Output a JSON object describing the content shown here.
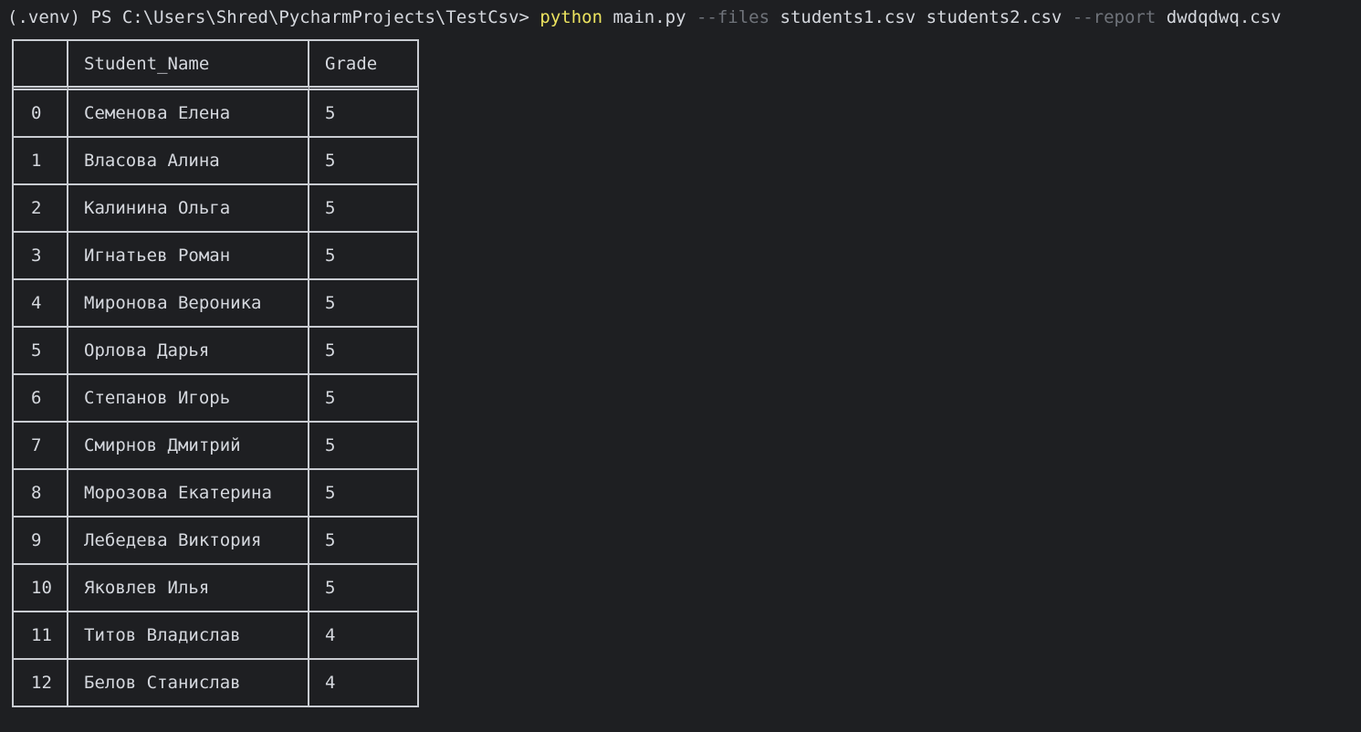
{
  "command": {
    "prompt": "(.venv) PS C:\\Users\\Shred\\PycharmProjects\\TestCsv> ",
    "executable": "python",
    "script": " main.py ",
    "files_flag": "--files",
    "files": " students1.csv students2.csv ",
    "report_flag": "--report",
    "report_file": " dwdqdwq.csv"
  },
  "table": {
    "headers": [
      "",
      "Student_Name",
      "Grade"
    ],
    "rows": [
      [
        "0",
        "Семенова Елена",
        "5"
      ],
      [
        "1",
        "Власова Алина",
        "5"
      ],
      [
        "2",
        "Калинина Ольга",
        "5"
      ],
      [
        "3",
        "Игнатьев Роман",
        "5"
      ],
      [
        "4",
        "Миронова Вероника",
        "5"
      ],
      [
        "5",
        "Орлова Дарья",
        "5"
      ],
      [
        "6",
        "Степанов Игорь",
        "5"
      ],
      [
        "7",
        "Смирнов Дмитрий",
        "5"
      ],
      [
        "8",
        "Морозова Екатерина",
        "5"
      ],
      [
        "9",
        "Лебедева Виктория",
        "5"
      ],
      [
        "10",
        "Яковлев Илья",
        "5"
      ],
      [
        "11",
        "Титов Владислав",
        "4"
      ],
      [
        "12",
        "Белов Станислав",
        "4"
      ]
    ]
  },
  "colors": {
    "background": "#1e1f22",
    "text": "#d5d8de",
    "executable": "#ece35f",
    "flag": "#6f737a",
    "border": "#c9ccd2"
  }
}
